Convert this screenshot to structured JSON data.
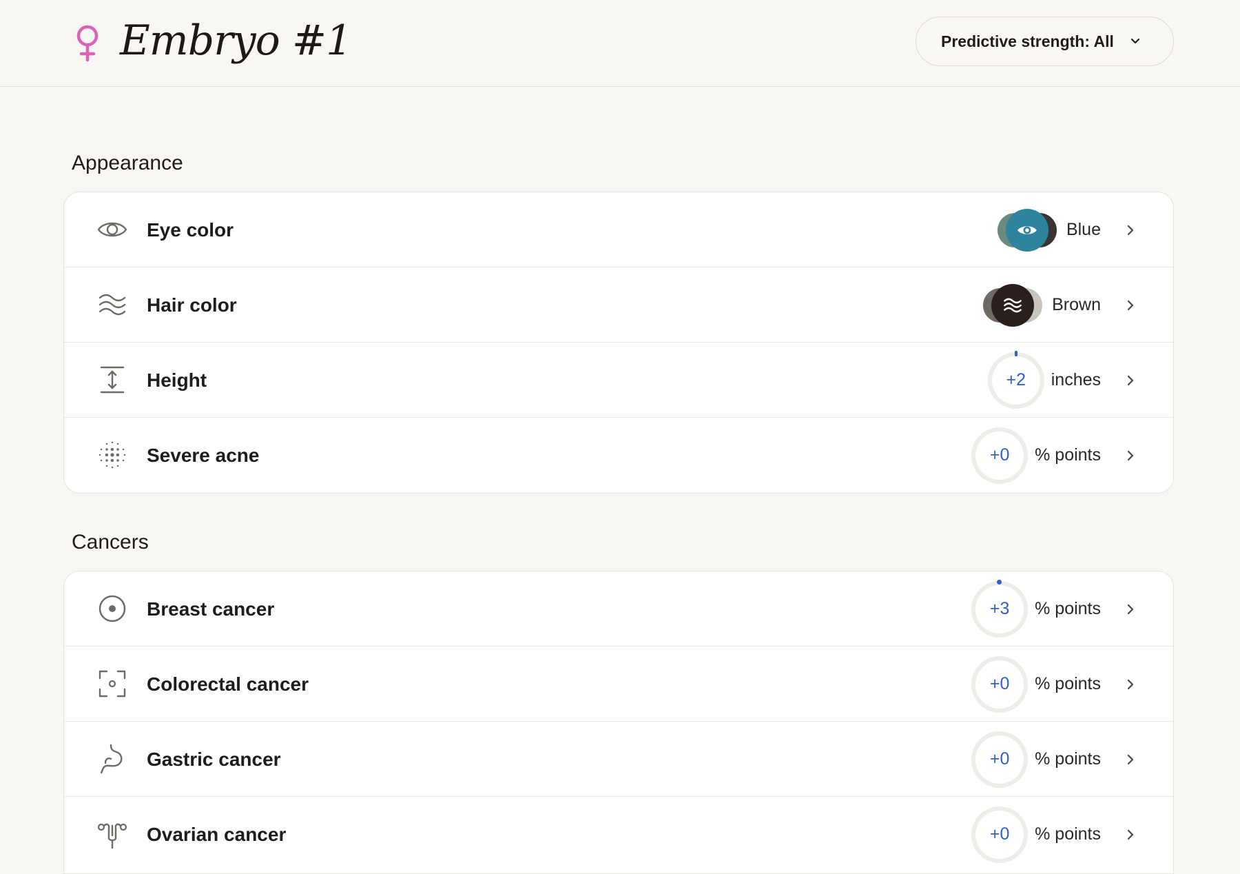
{
  "header": {
    "title": "Embryo #1",
    "sex_icon": "female-symbol-icon",
    "strength_filter": "Predictive strength: All"
  },
  "sections": [
    {
      "title": "Appearance",
      "rows": [
        {
          "label": "Eye color",
          "icon": "eye-icon",
          "value": "Blue",
          "indicator": "swatch",
          "colors": {
            "front": "#2e849c",
            "left": "#6b8a80",
            "right": "#3a3533"
          }
        },
        {
          "label": "Hair color",
          "icon": "waves-icon",
          "value": "Brown",
          "indicator": "swatch",
          "colors": {
            "front": "#2a1f1c",
            "left": "#6e6962",
            "right": "#c9c4bd"
          }
        },
        {
          "label": "Height",
          "icon": "height-arrows-icon",
          "delta": "+2",
          "unit": "inches",
          "indicator": "delta"
        },
        {
          "label": "Severe acne",
          "icon": "dotted-grid-icon",
          "delta": "+0",
          "unit": "% points",
          "indicator": "delta"
        }
      ]
    },
    {
      "title": "Cancers",
      "rows": [
        {
          "label": "Breast cancer",
          "icon": "target-circle-icon",
          "delta": "+3",
          "unit": "% points",
          "indicator": "delta"
        },
        {
          "label": "Colorectal cancer",
          "icon": "focus-frame-icon",
          "delta": "+0",
          "unit": "% points",
          "indicator": "delta"
        },
        {
          "label": "Gastric cancer",
          "icon": "stomach-icon",
          "delta": "+0",
          "unit": "% points",
          "indicator": "delta"
        },
        {
          "label": "Ovarian cancer",
          "icon": "uterus-icon",
          "delta": "+0",
          "unit": "% points",
          "indicator": "delta"
        }
      ]
    }
  ],
  "colors": {
    "accent_blue": "#2f5fd0",
    "female_pink": "#e05fb8",
    "background": "#f9f7f3"
  }
}
